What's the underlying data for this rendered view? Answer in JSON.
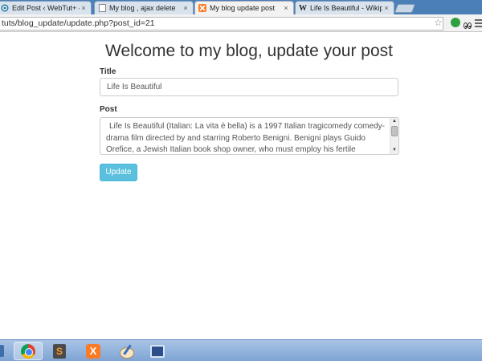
{
  "browser": {
    "tabs": [
      {
        "label": "Edit Post ‹ WebTut+ — W",
        "icon": "wordpress-icon",
        "active": false
      },
      {
        "label": "My blog , ajax delete",
        "icon": "blank-page-icon",
        "active": false
      },
      {
        "label": "My blog update post",
        "icon": "xampp-icon",
        "active": true
      },
      {
        "label": "Life Is Beautiful - Wikiped",
        "icon": "wikipedia-icon",
        "active": false
      }
    ],
    "tab_close_glyph": "×",
    "wikipedia_glyph": "W",
    "address": "tuts/blog_update/update.php?post_id=21",
    "star_glyph": "☆"
  },
  "page": {
    "heading": "Welcome to my blog, update your post",
    "title_label": "Title",
    "title_value": "Life Is Beautiful",
    "post_label": "Post",
    "post_value": "Life Is Beautiful (Italian: La vita è bella) is a 1997 Italian tragicomedy comedy-drama film directed by and starring Roberto Benigni. Benigni plays Guido Orefice, a Jewish Italian book shop owner, who must employ his fertile imagination to shield his son from the horrors of internment in a Nazi concentration camp. Part of the film",
    "update_button": "Update"
  },
  "taskbar": {
    "items": [
      {
        "name": "chrome-icon",
        "active": true
      },
      {
        "name": "sublime-text-icon",
        "active": false,
        "glyph": "S"
      },
      {
        "name": "xampp-icon",
        "active": false,
        "glyph": "X"
      },
      {
        "name": "paint-icon",
        "active": false
      },
      {
        "name": "remote-desktop-icon",
        "active": false
      }
    ]
  },
  "colors": {
    "button": "#5bc0de",
    "tabstrip": "#4a7fb8",
    "taskbar": "#7ea4d4"
  }
}
